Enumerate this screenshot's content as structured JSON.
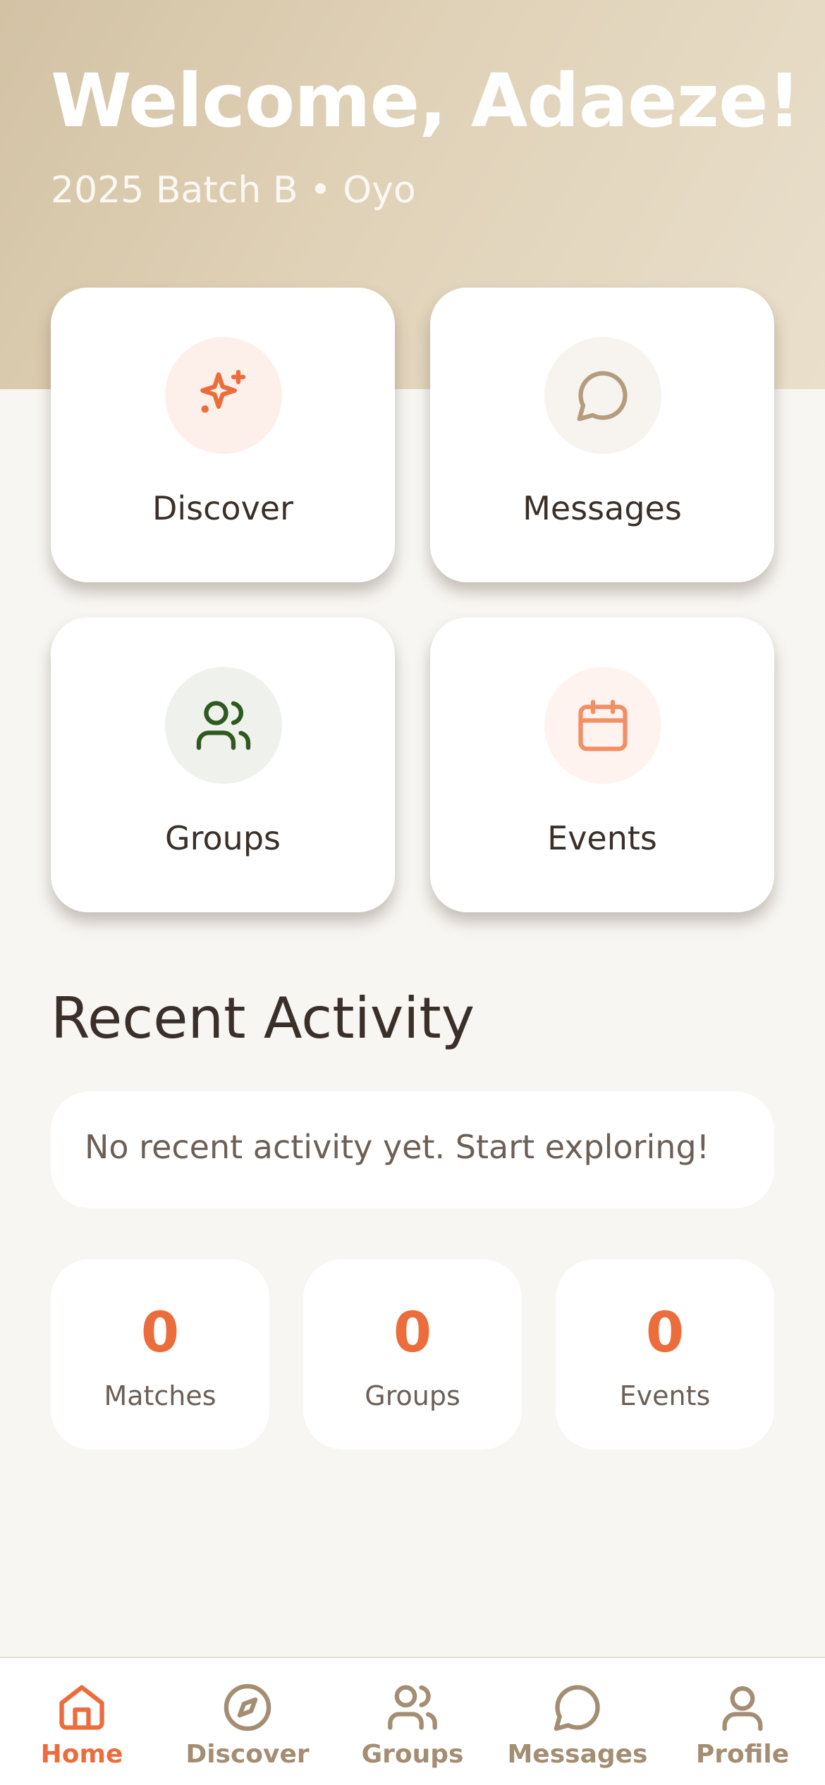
{
  "header": {
    "title": "Welcome, Adaeze!",
    "subtitle": "2025 Batch B • Oyo"
  },
  "quick_actions": [
    {
      "label": "Discover",
      "icon": "sparkles-icon",
      "icon_color": "#ec6d3b",
      "bg": "#fdf0ea"
    },
    {
      "label": "Messages",
      "icon": "chat-bubble-icon",
      "icon_color": "#b49c7f",
      "bg": "#f7f4f0"
    },
    {
      "label": "Groups",
      "icon": "users-icon",
      "icon_color": "#2f5a1f",
      "bg": "#eff1ed"
    },
    {
      "label": "Events",
      "icon": "calendar-icon",
      "icon_color": "#f19067",
      "bg": "#fef3ee"
    }
  ],
  "recent_activity": {
    "title": "Recent Activity",
    "empty_text": "No recent activity yet. Start exploring!"
  },
  "stats": [
    {
      "value": "0",
      "label": "Matches"
    },
    {
      "value": "0",
      "label": "Groups"
    },
    {
      "value": "0",
      "label": "Events"
    }
  ],
  "nav": [
    {
      "label": "Home",
      "icon": "home-icon",
      "active": true
    },
    {
      "label": "Discover",
      "icon": "compass-icon",
      "active": false
    },
    {
      "label": "Groups",
      "icon": "users-icon",
      "active": false
    },
    {
      "label": "Messages",
      "icon": "chat-bubble-icon",
      "active": false
    },
    {
      "label": "Profile",
      "icon": "user-icon",
      "active": false
    }
  ],
  "colors": {
    "accent": "#ec6d3b",
    "nav_inactive": "#a48e73",
    "text_dark": "#3a3029",
    "background": "#f8f6f3"
  }
}
